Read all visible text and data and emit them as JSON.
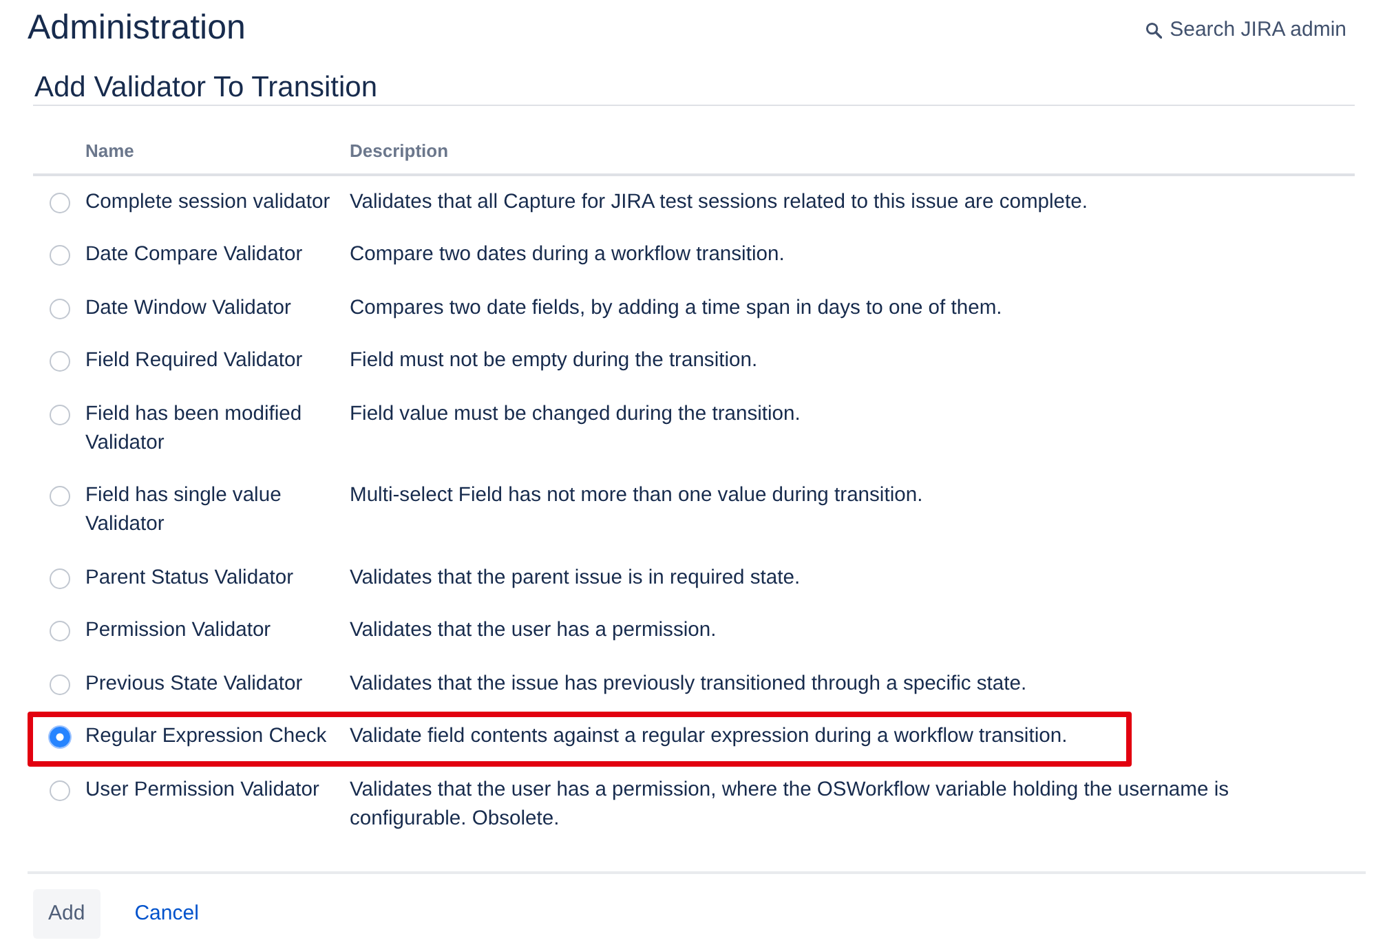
{
  "header": {
    "title": "Administration",
    "search_link": "Search JIRA admin"
  },
  "section_title": "Add Validator To Transition",
  "table": {
    "columns": [
      "Name",
      "Description"
    ],
    "rows": [
      {
        "name": "Complete session validator",
        "description": "Validates that all Capture for JIRA test sessions related to this issue are complete.",
        "selected": false,
        "highlighted": false
      },
      {
        "name": "Date Compare Validator",
        "description": "Compare two dates during a workflow transition.",
        "selected": false,
        "highlighted": false
      },
      {
        "name": "Date Window Validator",
        "description": "Compares two date fields, by adding a time span in days to one of them.",
        "selected": false,
        "highlighted": false
      },
      {
        "name": "Field Required Validator",
        "description": "Field must not be empty during the transition.",
        "selected": false,
        "highlighted": false
      },
      {
        "name": "Field has been modified Validator",
        "description": "Field value must be changed during the transition.",
        "selected": false,
        "highlighted": false
      },
      {
        "name": "Field has single value Validator",
        "description": "Multi-select Field has not more than one value during transition.",
        "selected": false,
        "highlighted": false
      },
      {
        "name": "Parent Status Validator",
        "description": "Validates that the parent issue is in required state.",
        "selected": false,
        "highlighted": false
      },
      {
        "name": "Permission Validator",
        "description": "Validates that the user has a permission.",
        "selected": false,
        "highlighted": false
      },
      {
        "name": "Previous State Validator",
        "description": "Validates that the issue has previously transitioned through a specific state.",
        "selected": false,
        "highlighted": false
      },
      {
        "name": "Regular Expression Check",
        "description": "Validate field contents against a regular expression during a workflow transition.",
        "selected": true,
        "highlighted": true
      },
      {
        "name": "User Permission Validator",
        "description": "Validates that the user has a permission, where the OSWorkflow variable holding the username is configurable. Obsolete.",
        "selected": false,
        "highlighted": false
      }
    ]
  },
  "buttons": [
    {
      "label": "Add",
      "kind": "button"
    },
    {
      "label": "Cancel",
      "kind": "link"
    }
  ]
}
